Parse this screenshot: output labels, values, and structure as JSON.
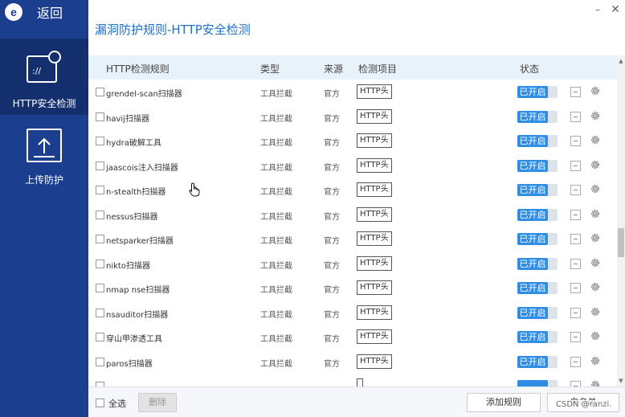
{
  "app": {
    "back_label": "返回",
    "logo_letter": "e",
    "page_title": "漏洞防护规则-HTTP安全检测"
  },
  "window": {
    "minimize_glyph": "–",
    "close_glyph": "✕"
  },
  "sidebar": {
    "items": [
      {
        "label": "HTTP安全检测",
        "icon": "http-monitor-icon",
        "active": true
      },
      {
        "label": "上传防护",
        "icon": "upload-icon",
        "active": false
      }
    ]
  },
  "table": {
    "headers": {
      "rule": "HTTP检测规则",
      "type": "类型",
      "source": "来源",
      "item": "检测项目",
      "status": "状态"
    },
    "rows": [
      {
        "name": "grendel-scan扫描器",
        "type": "工具拦截",
        "source": "官方",
        "item": "HTTP头",
        "status": "已开启"
      },
      {
        "name": "havij扫描器",
        "type": "工具拦截",
        "source": "官方",
        "item": "HTTP头",
        "status": "已开启"
      },
      {
        "name": "hydra破解工具",
        "type": "工具拦截",
        "source": "官方",
        "item": "HTTP头",
        "status": "已开启"
      },
      {
        "name": "jaascois注入扫描器",
        "type": "工具拦截",
        "source": "官方",
        "item": "HTTP头",
        "status": "已开启"
      },
      {
        "name": "n-stealth扫描器",
        "type": "工具拦截",
        "source": "官方",
        "item": "HTTP头",
        "status": "已开启"
      },
      {
        "name": "nessus扫描器",
        "type": "工具拦截",
        "source": "官方",
        "item": "HTTP头",
        "status": "已开启"
      },
      {
        "name": "netsparker扫描器",
        "type": "工具拦截",
        "source": "官方",
        "item": "HTTP头",
        "status": "已开启"
      },
      {
        "name": "nikto扫描器",
        "type": "工具拦截",
        "source": "官方",
        "item": "HTTP头",
        "status": "已开启"
      },
      {
        "name": "nmap nse扫描器",
        "type": "工具拦截",
        "source": "官方",
        "item": "HTTP头",
        "status": "已开启"
      },
      {
        "name": "nsauditor扫描器",
        "type": "工具拦截",
        "source": "官方",
        "item": "HTTP头",
        "status": "已开启"
      },
      {
        "name": "穿山甲渗透工具",
        "type": "工具拦截",
        "source": "官方",
        "item": "HTTP头",
        "status": "已开启"
      },
      {
        "name": "paros扫描器",
        "type": "工具拦截",
        "source": "官方",
        "item": "HTTP头",
        "status": "已开启"
      },
      {
        "name": "",
        "type": "",
        "source": "",
        "item": "",
        "status": ""
      }
    ]
  },
  "footer": {
    "select_all": "全选",
    "delete": "删除",
    "add_rule": "添加规则",
    "whitelist": "白名单"
  },
  "watermark": "CSDN @ranzi.",
  "colors": {
    "sidebar_bg": "#1b3f8e",
    "sidebar_active": "#142f6d",
    "title_blue": "#1f6fc9",
    "toggle_on": "#2f8de4",
    "header_bg": "#e8f2fa"
  }
}
